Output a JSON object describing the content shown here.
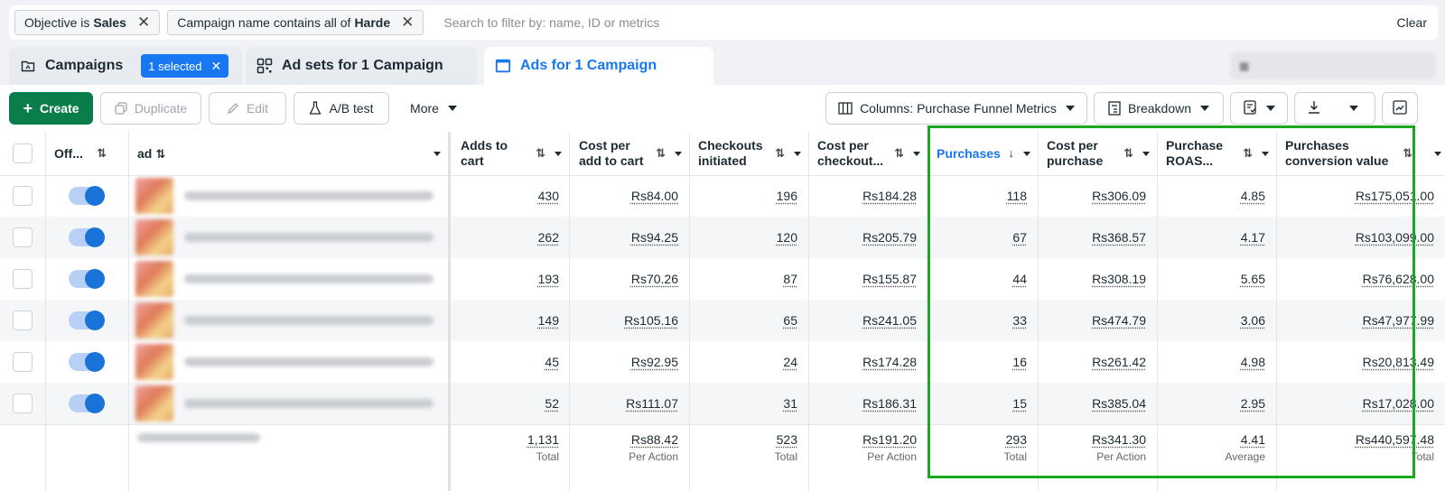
{
  "filters": {
    "chips": [
      {
        "prefix": "Objective is",
        "value": "Sales"
      },
      {
        "prefix": "Campaign name contains all of",
        "value": "Harde"
      }
    ],
    "search_placeholder": "Search to filter by: name, ID or metrics",
    "clear_label": "Clear"
  },
  "tabs": {
    "campaigns": "Campaigns",
    "selected_badge": "1 selected",
    "adsets": "Ad sets for 1 Campaign",
    "ads": "Ads for 1 Campaign"
  },
  "toolbar": {
    "create": "Create",
    "duplicate": "Duplicate",
    "edit": "Edit",
    "ab_test": "A/B test",
    "more": "More",
    "columns": "Columns: Purchase Funnel Metrics",
    "breakdown": "Breakdown"
  },
  "table": {
    "headers": {
      "off": "Off...",
      "ad": "ad",
      "adds_to_cart": "Adds to cart",
      "cost_per_add": "Cost per add to cart",
      "checkouts": "Checkouts initiated",
      "cost_per_checkout": "Cost per checkout...",
      "purchases": "Purchases",
      "cost_per_purchase": "Cost per purchase",
      "roas": "Purchase ROAS...",
      "conv_value": "Purchases conversion value"
    },
    "rows": [
      {
        "adds": "430",
        "cost_add": "Rs84.00",
        "checkouts": "196",
        "cost_checkout": "Rs184.28",
        "purchases": "118",
        "cost_purchase": "Rs306.09",
        "roas": "4.85",
        "value": "Rs175,051.00"
      },
      {
        "adds": "262",
        "cost_add": "Rs94.25",
        "checkouts": "120",
        "cost_checkout": "Rs205.79",
        "purchases": "67",
        "cost_purchase": "Rs368.57",
        "roas": "4.17",
        "value": "Rs103,099.00"
      },
      {
        "adds": "193",
        "cost_add": "Rs70.26",
        "checkouts": "87",
        "cost_checkout": "Rs155.87",
        "purchases": "44",
        "cost_purchase": "Rs308.19",
        "roas": "5.65",
        "value": "Rs76,628.00"
      },
      {
        "adds": "149",
        "cost_add": "Rs105.16",
        "checkouts": "65",
        "cost_checkout": "Rs241.05",
        "purchases": "33",
        "cost_purchase": "Rs474.79",
        "roas": "3.06",
        "value": "Rs47,977.99"
      },
      {
        "adds": "45",
        "cost_add": "Rs92.95",
        "checkouts": "24",
        "cost_checkout": "Rs174.28",
        "purchases": "16",
        "cost_purchase": "Rs261.42",
        "roas": "4.98",
        "value": "Rs20,813.49"
      },
      {
        "adds": "52",
        "cost_add": "Rs111.07",
        "checkouts": "31",
        "cost_checkout": "Rs186.31",
        "purchases": "15",
        "cost_purchase": "Rs385.04",
        "roas": "2.95",
        "value": "Rs17,028.00"
      }
    ],
    "totals": {
      "adds": {
        "value": "1,131",
        "label": "Total"
      },
      "cost_add": {
        "value": "Rs88.42",
        "label": "Per Action"
      },
      "checkouts": {
        "value": "523",
        "label": "Total"
      },
      "cost_checkout": {
        "value": "Rs191.20",
        "label": "Per Action"
      },
      "purchases": {
        "value": "293",
        "label": "Total"
      },
      "cost_purchase": {
        "value": "Rs341.30",
        "label": "Per Action"
      },
      "roas": {
        "value": "4.41",
        "label": "Average"
      },
      "value": {
        "value": "Rs440,597.48",
        "label": "Total"
      }
    }
  },
  "colors": {
    "accent": "#1877f2",
    "create_button": "#0a7e4a",
    "highlight_box": "#1aa821",
    "toggle_on": "#1a73d9"
  }
}
